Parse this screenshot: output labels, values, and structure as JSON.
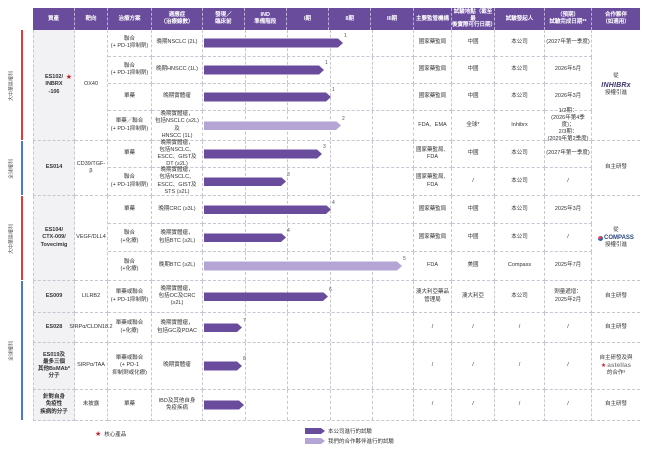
{
  "colors": {
    "header_bg": "#6a4c9c",
    "bar_self": "#6a4c9c",
    "bar_partner": "#b4a5d4",
    "core_star": "#cc1f26",
    "band_greater_china": "#e03a3a",
    "band_global": "#4a7bc8",
    "asset_col_bg": "#f2f1f4",
    "grid_line": "#c9c5d2",
    "astellas_red": "#d01f2f"
  },
  "header": {
    "asset": "資產",
    "target": "靶向",
    "regimen": "治療方案",
    "indication": "適應症\n（治療線數）",
    "phases": [
      "發現／\n臨床前",
      "IND\n準備階段",
      "I期",
      "II期",
      "III期"
    ],
    "regulator": "主要監管機構",
    "location": "試驗地點（截至最\n後實際可行日期）",
    "sponsor": "試驗發起人",
    "milestone": "（預期）\n試驗完成日期**",
    "partner": "合作夥伴\n（如適用）"
  },
  "side_bands": [
    {
      "label": "大中華區權利",
      "color_key": "band_greater_china",
      "from_row": 0,
      "to_row": 3
    },
    {
      "label": "全球權利",
      "color_key": "band_global",
      "from_row": 4,
      "to_row": 5
    },
    {
      "label": "大中華區權利",
      "color_key": "band_greater_china",
      "from_row": 6,
      "to_row": 8
    },
    {
      "label": "全球權利",
      "color_key": "band_global",
      "from_row": 9,
      "to_row": 12
    }
  ],
  "groups": [
    {
      "asset": "ES102/\nINBRX\n-106",
      "core_product": true,
      "target": "OX40",
      "rows": [
        0,
        1,
        2,
        3
      ],
      "partner": {
        "parts": [
          {
            "text": "從"
          },
          {
            "logo": "inhibrx"
          },
          {
            "text": "授權引進"
          }
        ]
      }
    },
    {
      "asset": "ES014",
      "core_product": false,
      "target": "CD39/TGF-β",
      "rows": [
        4,
        5
      ],
      "partner": {
        "parts": [
          {
            "text": "自主研發"
          }
        ]
      }
    },
    {
      "asset": "ES104/\nCTX-009/\nTovecimig",
      "core_product": false,
      "target": "VEGF/DLL4",
      "rows": [
        6,
        7,
        8
      ],
      "partner": {
        "parts": [
          {
            "text": "從"
          },
          {
            "logo": "compass"
          },
          {
            "text": "授權引進"
          }
        ]
      }
    },
    {
      "asset": "ES009",
      "core_product": false,
      "target": "LILRB2",
      "rows": [
        9
      ],
      "partner": {
        "parts": [
          {
            "text": "自主研發"
          }
        ]
      }
    },
    {
      "asset": "ES028",
      "core_product": false,
      "target": "SIRPα/CLDN18.2",
      "rows": [
        10
      ],
      "partner": {
        "parts": [
          {
            "text": "自主研發"
          }
        ]
      }
    },
    {
      "asset": "ES019及\n最多三個\n其他BsMAb*\n分子",
      "core_product": false,
      "target": "SIRPα/TAA",
      "rows": [
        11
      ],
      "partner": {
        "parts": [
          {
            "text": "自主研發及與"
          },
          {
            "logo": "astellas"
          },
          {
            "text": "的合作³"
          }
        ]
      }
    },
    {
      "asset": "針對自身\n免疫性\n疾病的分子",
      "core_product": false,
      "target": "未披露",
      "rows": [
        12
      ],
      "partner": {
        "parts": [
          {
            "text": "自主研發"
          }
        ]
      }
    }
  ],
  "rows": [
    {
      "regimen": "聯合\n(+ PD-1抑制劑)",
      "indication": "晚期NSCLC (2L)",
      "bar": {
        "type": "self",
        "progress": 0.66,
        "label": "1"
      },
      "regulator": "國家藥監局",
      "location": "中國",
      "sponsor": "本公司",
      "milestone": "(2027年第一季度)"
    },
    {
      "regimen": "聯合\n(+ PD-1抑制劑)",
      "indication": "晚期HNSCC (1L)",
      "bar": {
        "type": "self",
        "progress": 0.57,
        "label": "1"
      },
      "regulator": "國家藥監局",
      "location": "中國",
      "sponsor": "本公司",
      "milestone": "2026年5月"
    },
    {
      "regimen": "單藥",
      "indication": "晚期實體瘤",
      "bar": {
        "type": "self",
        "progress": 0.6,
        "label": "1"
      },
      "regulator": "國家藥監局",
      "location": "中國",
      "sponsor": "本公司",
      "milestone": "2026年3月"
    },
    {
      "regimen": "單藥／聯合\n(+ PD-1抑制劑)",
      "indication": "晚期實體瘤，\n包括NSCLC (≥2L)及\nHNSCC (1L)",
      "bar": {
        "type": "partner",
        "progress": 0.65,
        "label": "2"
      },
      "regulator": "FDA、EMA",
      "location": "全球*",
      "sponsor": "Inhibrx",
      "milestone": "1/2期：\n(2026年第4季度)；\n2/3期：\n(2029年第2季度)"
    },
    {
      "regimen": "單藥",
      "indication": "晚期實體瘤，\n包括NSCLC、\nESCC、GIST及\nDT (≥2L)",
      "bar": {
        "type": "self",
        "progress": 0.56,
        "label": "3"
      },
      "regulator": "國家藥監局、\nFDA",
      "location": "中國",
      "sponsor": "本公司",
      "milestone": "(2027年第一季度)"
    },
    {
      "regimen": "聯合\n(+ PD-1抑制劑)",
      "indication": "晚期實體瘤，\n包括NSCLC、\nESCC、GIST及\nSTS (≥2L)",
      "bar": {
        "type": "self",
        "progress": 0.39,
        "label": "3"
      },
      "regulator": "國家藥監局、\nFDA",
      "location": "/",
      "sponsor": "本公司",
      "milestone": "/"
    },
    {
      "regimen": "單藥",
      "indication": "晚期CRC (≥3L)",
      "bar": {
        "type": "self",
        "progress": 0.6,
        "label": "4"
      },
      "regulator": "國家藥監局",
      "location": "中國",
      "sponsor": "本公司",
      "milestone": "2025年3月"
    },
    {
      "regimen": "聯合\n(+化療)",
      "indication": "晚期實體瘤，\n包括BTC (≥2L)",
      "bar": {
        "type": "self",
        "progress": 0.39,
        "label": "4"
      },
      "regulator": "國家藥監局",
      "location": "中國",
      "sponsor": "本公司",
      "milestone": "/"
    },
    {
      "regimen": "聯合\n(+化療)",
      "indication": "晚期BTC (≥2L)",
      "bar": {
        "type": "partner",
        "progress": 0.94,
        "label": "5"
      },
      "regulator": "FDA",
      "location": "美國",
      "sponsor": "Compass",
      "milestone": "2025年7月"
    },
    {
      "regimen": "單藥或聯合\n(+ PD-1抑制劑)",
      "indication": "晚期實體瘤，\n包括OC及CRC (≥2L)",
      "bar": {
        "type": "self",
        "progress": 0.59,
        "label": "6"
      },
      "regulator": "澳大利亞藥品\n管理局",
      "location": "澳大利亞",
      "sponsor": "本公司",
      "milestone": "劑量遞增：\n2025年2月"
    },
    {
      "regimen": "單藥或聯合\n(+化療)",
      "indication": "晚期實體瘤，\n包括GC及PDAC",
      "bar": {
        "type": "self",
        "progress": 0.18,
        "label": "7"
      },
      "regulator": "/",
      "location": "/",
      "sponsor": "/",
      "milestone": "/"
    },
    {
      "regimen": "單藥或聯合\n(+ PD-1\n抑制劑或化療)",
      "indication": "晚期實體瘤",
      "bar": {
        "type": "self",
        "progress": 0.18,
        "label": "8"
      },
      "regulator": "/",
      "location": "/",
      "sponsor": "/",
      "milestone": "/"
    },
    {
      "regimen": "單藥",
      "indication": "IBD及其他自身\n免疫疾病",
      "bar": {
        "type": "self",
        "progress": 0.19,
        "label": ""
      },
      "regulator": "/",
      "location": "/",
      "sponsor": "/",
      "milestone": "/"
    }
  ],
  "logos": {
    "inhibrx": {
      "text": "INHIBRx",
      "color": "#38336e"
    },
    "compass": {
      "text": "COMPASS",
      "color": "#27477f"
    },
    "astellas": {
      "text": "astellas",
      "color": "#8b8d8e",
      "star": "★"
    }
  },
  "legend": {
    "core": "核心產品",
    "self_trial": "本公司進行的試驗",
    "partner_trial": "我們的合作夥伴進行的試驗"
  },
  "chart_data": {
    "type": "bar",
    "title": "",
    "x_axis_phases": [
      "發現／臨床前",
      "IND準備階段",
      "I期",
      "II期",
      "III期"
    ],
    "value_scale": "0-5，每一單位代表一個研發階段",
    "legend": {
      "self": "本公司進行的試驗",
      "partner": "我們的合作夥伴進行的試驗"
    },
    "series": [
      {
        "asset": "ES102/INBRX-106",
        "indication": "晚期NSCLC (2L)",
        "phase_progress": 3.3,
        "conducted_by": "self",
        "footnote": "1"
      },
      {
        "asset": "ES102/INBRX-106",
        "indication": "晚期HNSCC (1L)",
        "phase_progress": 2.85,
        "conducted_by": "self",
        "footnote": "1"
      },
      {
        "asset": "ES102/INBRX-106",
        "indication": "晚期實體瘤",
        "phase_progress": 3.0,
        "conducted_by": "self",
        "footnote": "1"
      },
      {
        "asset": "ES102/INBRX-106",
        "indication": "晚期實體瘤，包括NSCLC (≥2L)及HNSCC (1L)",
        "phase_progress": 3.25,
        "conducted_by": "partner",
        "footnote": "2"
      },
      {
        "asset": "ES014",
        "indication": "晚期實體瘤，包括NSCLC、ESCC、GIST及DT (≥2L)",
        "phase_progress": 2.8,
        "conducted_by": "self",
        "footnote": "3"
      },
      {
        "asset": "ES014",
        "indication": "晚期實體瘤，包括NSCLC、ESCC、GIST及STS (≥2L)",
        "phase_progress": 1.95,
        "conducted_by": "self",
        "footnote": "3"
      },
      {
        "asset": "ES104/CTX-009/Tovecimig",
        "indication": "晚期CRC (≥3L)",
        "phase_progress": 3.0,
        "conducted_by": "self",
        "footnote": "4"
      },
      {
        "asset": "ES104/CTX-009/Tovecimig",
        "indication": "晚期實體瘤，包括BTC (≥2L)",
        "phase_progress": 1.95,
        "conducted_by": "self",
        "footnote": "4"
      },
      {
        "asset": "ES104/CTX-009/Tovecimig",
        "indication": "晚期BTC (≥2L)",
        "phase_progress": 4.7,
        "conducted_by": "partner",
        "footnote": "5"
      },
      {
        "asset": "ES009",
        "indication": "晚期實體瘤，包括OC及CRC (≥2L)",
        "phase_progress": 2.95,
        "conducted_by": "self",
        "footnote": "6"
      },
      {
        "asset": "ES028",
        "indication": "晚期實體瘤，包括GC及PDAC",
        "phase_progress": 0.9,
        "conducted_by": "self",
        "footnote": "7"
      },
      {
        "asset": "ES019及最多三個其他BsMAb*分子",
        "indication": "晚期實體瘤",
        "phase_progress": 0.9,
        "conducted_by": "self",
        "footnote": "8"
      },
      {
        "asset": "針對自身免疫性疾病的分子",
        "indication": "IBD及其他自身免疫疾病",
        "phase_progress": 0.95,
        "conducted_by": "self",
        "footnote": ""
      }
    ]
  }
}
